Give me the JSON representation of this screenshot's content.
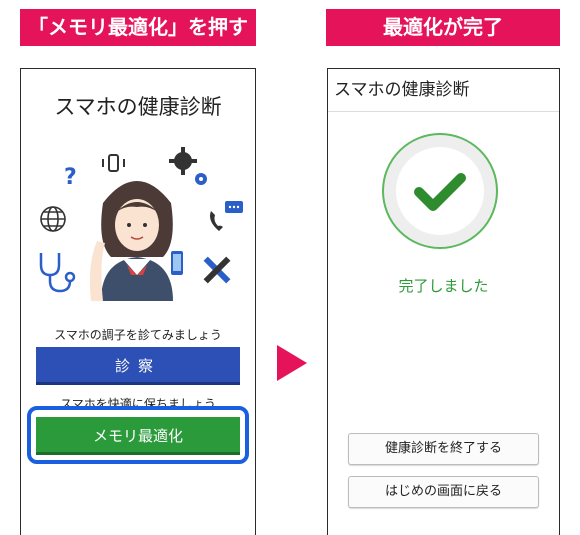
{
  "labels": {
    "left": "「メモリ最適化」を押す",
    "right": "最適化が完了"
  },
  "left_screen": {
    "title": "スマホの健康診断",
    "caption_check": "スマホの調子を診てみましょう",
    "diagnose_button": "診察",
    "caption_comfort": "スマホを快適に保ちましょう",
    "memory_button": "メモリ最適化",
    "icons": [
      "question-icon",
      "vibrate-icon",
      "gear-icon",
      "globe-icon",
      "phone-chat-icon",
      "stethoscope-icon",
      "tools-icon"
    ]
  },
  "right_screen": {
    "title": "スマホの健康診断",
    "status": "完了しました",
    "end_button": "健康診断を終了する",
    "home_button": "はじめの画面に戻る"
  },
  "colors": {
    "label_bg": "#e5135a",
    "diagnose_blue": "#2c50b5",
    "memory_green": "#2a9a3a",
    "highlight_blue": "#1a5fe0",
    "check_green": "#2e8b2e"
  }
}
